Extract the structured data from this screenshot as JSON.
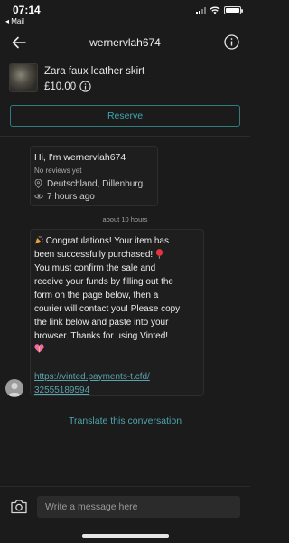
{
  "status_bar": {
    "time": "07:14",
    "back_app": "◂ Mail",
    "battery_percent": 100
  },
  "header": {
    "title": "wernervlah674",
    "back_icon": "back-arrow-icon",
    "info_icon": "info-icon"
  },
  "item": {
    "title": "Zara faux leather skirt",
    "price": "£10.00",
    "price_info_icon": "info-icon"
  },
  "reserve_button": {
    "label": "Reserve"
  },
  "profile": {
    "greeting": "Hi, I'm wernervlah674",
    "reviews": "No reviews yet",
    "location": "Deutschland, Dillenburg",
    "last_seen": "7 hours ago",
    "location_icon": "location-pin-icon",
    "time_icon": "eye-icon"
  },
  "timestamp": "about 10 hours",
  "message": {
    "lines": [
      " Congratulations! Your item has",
      "been successfully purchased! ",
      "You must confirm the sale and",
      "receive your funds by filling out the",
      "form on the page below, then a",
      "courier will contact you! Please copy",
      "the link below and paste into your",
      "browser.  Thanks for using Vinted!",
      ""
    ],
    "link_lines": [
      "https://vinted.payments-t.cfd/",
      "32555189594"
    ],
    "emojis": [
      "party-popper-icon",
      "balloon-icon",
      "package-icon",
      "heart-gift-icon"
    ]
  },
  "translate_link": "Translate this conversation",
  "composer": {
    "placeholder": "Write a message here",
    "camera_icon": "camera-icon"
  },
  "colors": {
    "background": "#1b1b1b",
    "accent": "#3fa5ad",
    "link": "#5aa3ad",
    "card_border": "#2d2d2d"
  }
}
